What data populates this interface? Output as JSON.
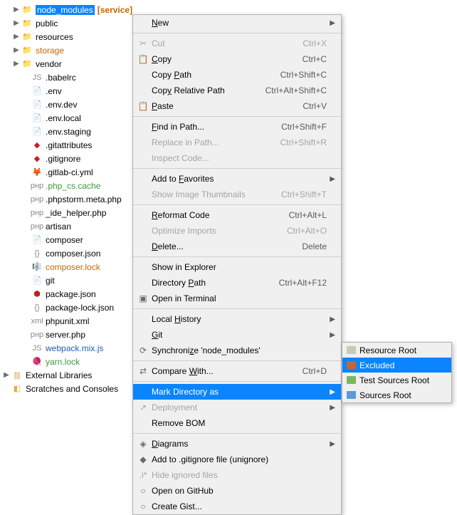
{
  "tree": {
    "items": [
      {
        "chev": true,
        "depth": 0,
        "icon": "folder",
        "iconClass": "folder",
        "label": "node_modules",
        "labelClass": "orange",
        "tag": "[service]",
        "sel": true
      },
      {
        "chev": true,
        "depth": 0,
        "icon": "folder",
        "iconClass": "folder-gray",
        "label": "public"
      },
      {
        "chev": true,
        "depth": 0,
        "icon": "folder",
        "iconClass": "folder-gray",
        "label": "resources"
      },
      {
        "chev": true,
        "depth": 0,
        "icon": "folder",
        "iconClass": "folder-gray",
        "label": "storage",
        "labelClass": "orange"
      },
      {
        "chev": true,
        "depth": 0,
        "icon": "folder",
        "iconClass": "folder-gray",
        "label": "vendor"
      },
      {
        "depth": 1,
        "icon": "js",
        "iconClass": "gray",
        "label": ".babelrc"
      },
      {
        "depth": 1,
        "icon": "file",
        "iconClass": "gray",
        "label": ".env"
      },
      {
        "depth": 1,
        "icon": "file",
        "iconClass": "gray",
        "label": ".env.dev"
      },
      {
        "depth": 1,
        "icon": "file",
        "iconClass": "gray",
        "label": ".env.local"
      },
      {
        "depth": 1,
        "icon": "file",
        "iconClass": "gray",
        "label": ".env.staging"
      },
      {
        "depth": 1,
        "icon": "git",
        "iconClass": "red",
        "label": ".gitattributes"
      },
      {
        "depth": 1,
        "icon": "git",
        "iconClass": "red",
        "label": ".gitignore"
      },
      {
        "depth": 1,
        "icon": "gitlab",
        "iconClass": "orange",
        "label": ".gitlab-ci.yml"
      },
      {
        "depth": 1,
        "icon": "php",
        "iconClass": "gray",
        "label": ".php_cs.cache",
        "labelClass": "green"
      },
      {
        "depth": 1,
        "icon": "php",
        "iconClass": "gray",
        "label": ".phpstorm.meta.php"
      },
      {
        "depth": 1,
        "icon": "php",
        "iconClass": "gray",
        "label": "_ide_helper.php"
      },
      {
        "depth": 1,
        "icon": "php",
        "iconClass": "gray",
        "label": "artisan"
      },
      {
        "depth": 1,
        "icon": "file",
        "iconClass": "gray",
        "label": "composer"
      },
      {
        "depth": 1,
        "icon": "json",
        "iconClass": "gray",
        "label": "composer.json"
      },
      {
        "depth": 1,
        "icon": "composer",
        "iconClass": "orange",
        "label": "composer.lock",
        "labelClass": "orange"
      },
      {
        "depth": 1,
        "icon": "file",
        "iconClass": "gray",
        "label": "git"
      },
      {
        "depth": 1,
        "icon": "npm",
        "iconClass": "red",
        "label": "package.json"
      },
      {
        "depth": 1,
        "icon": "json",
        "iconClass": "gray",
        "label": "package-lock.json"
      },
      {
        "depth": 1,
        "icon": "xml",
        "iconClass": "gray",
        "label": "phpunit.xml"
      },
      {
        "depth": 1,
        "icon": "php",
        "iconClass": "gray",
        "label": "server.php"
      },
      {
        "depth": 1,
        "icon": "js",
        "iconClass": "gray",
        "label": "webpack.mix.js",
        "labelClass": "blue"
      },
      {
        "depth": 1,
        "icon": "yarn",
        "iconClass": "blue",
        "label": "yarn.lock",
        "labelClass": "green"
      }
    ],
    "extlib": {
      "chev": true,
      "icon": "lib",
      "label": "External Libraries"
    },
    "scratches": {
      "icon": "scratch",
      "label": "Scratches and Consoles"
    }
  },
  "menu": {
    "groups": [
      [
        {
          "label": "New",
          "arrow": true,
          "mn": "N"
        }
      ],
      [
        {
          "icon": "✂",
          "label": "Cut",
          "shortcut": "Ctrl+X",
          "disabled": true
        },
        {
          "icon": "📋",
          "label": "Copy",
          "shortcut": "Ctrl+C",
          "mn": "C"
        },
        {
          "label": "Copy Path",
          "shortcut": "Ctrl+Shift+C",
          "mn": "P"
        },
        {
          "label": "Copy Relative Path",
          "shortcut": "Ctrl+Alt+Shift+C",
          "mn": "y"
        },
        {
          "icon": "📋",
          "label": "Paste",
          "shortcut": "Ctrl+V",
          "mn": "P"
        }
      ],
      [
        {
          "label": "Find in Path...",
          "shortcut": "Ctrl+Shift+F",
          "mn": "F"
        },
        {
          "label": "Replace in Path...",
          "shortcut": "Ctrl+Shift+R",
          "disabled": true
        },
        {
          "label": "Inspect Code...",
          "disabled": true
        }
      ],
      [
        {
          "label": "Add to Favorites",
          "arrow": true,
          "mn": "F"
        },
        {
          "label": "Show Image Thumbnails",
          "shortcut": "Ctrl+Shift+T",
          "disabled": true
        }
      ],
      [
        {
          "label": "Reformat Code",
          "shortcut": "Ctrl+Alt+L",
          "mn": "R"
        },
        {
          "label": "Optimize Imports",
          "shortcut": "Ctrl+Alt+O",
          "disabled": true
        },
        {
          "label": "Delete...",
          "shortcut": "Delete",
          "mn": "D"
        }
      ],
      [
        {
          "label": "Show in Explorer"
        },
        {
          "label": "Directory Path",
          "shortcut": "Ctrl+Alt+F12",
          "mn": "P"
        },
        {
          "icon": "▣",
          "label": "Open in Terminal"
        }
      ],
      [
        {
          "label": "Local History",
          "arrow": true,
          "mn": "H"
        },
        {
          "label": "Git",
          "arrow": true,
          "mn": "G"
        },
        {
          "icon": "⟳",
          "label": "Synchronize 'node_modules'",
          "mn": "z"
        }
      ],
      [
        {
          "icon": "⇄",
          "label": "Compare With...",
          "shortcut": "Ctrl+D",
          "mn": "W"
        }
      ],
      [
        {
          "label": "Mark Directory as",
          "arrow": true,
          "hl": true
        },
        {
          "icon": "↗",
          "label": "Deployment",
          "arrow": true,
          "disabled": true
        },
        {
          "label": "Remove BOM"
        }
      ],
      [
        {
          "icon": "◈",
          "label": "Diagrams",
          "arrow": true,
          "mn": "D"
        },
        {
          "icon": "◆",
          "label": "Add to .gitignore file (unignore)"
        },
        {
          "label": "Hide ignored files",
          "disabled": true,
          "icon": ".i*"
        },
        {
          "icon": "○",
          "label": "Open on GitHub"
        },
        {
          "icon": "○",
          "label": "Create Gist..."
        }
      ]
    ]
  },
  "submenu": {
    "items": [
      {
        "color": "#c9c9b8",
        "label": "Resource Root"
      },
      {
        "color": "#c1683a",
        "label": "Excluded",
        "hl": true
      },
      {
        "color": "#7bb661",
        "label": "Test Sources Root"
      },
      {
        "color": "#5a9bd5",
        "label": "Sources Root"
      }
    ]
  }
}
